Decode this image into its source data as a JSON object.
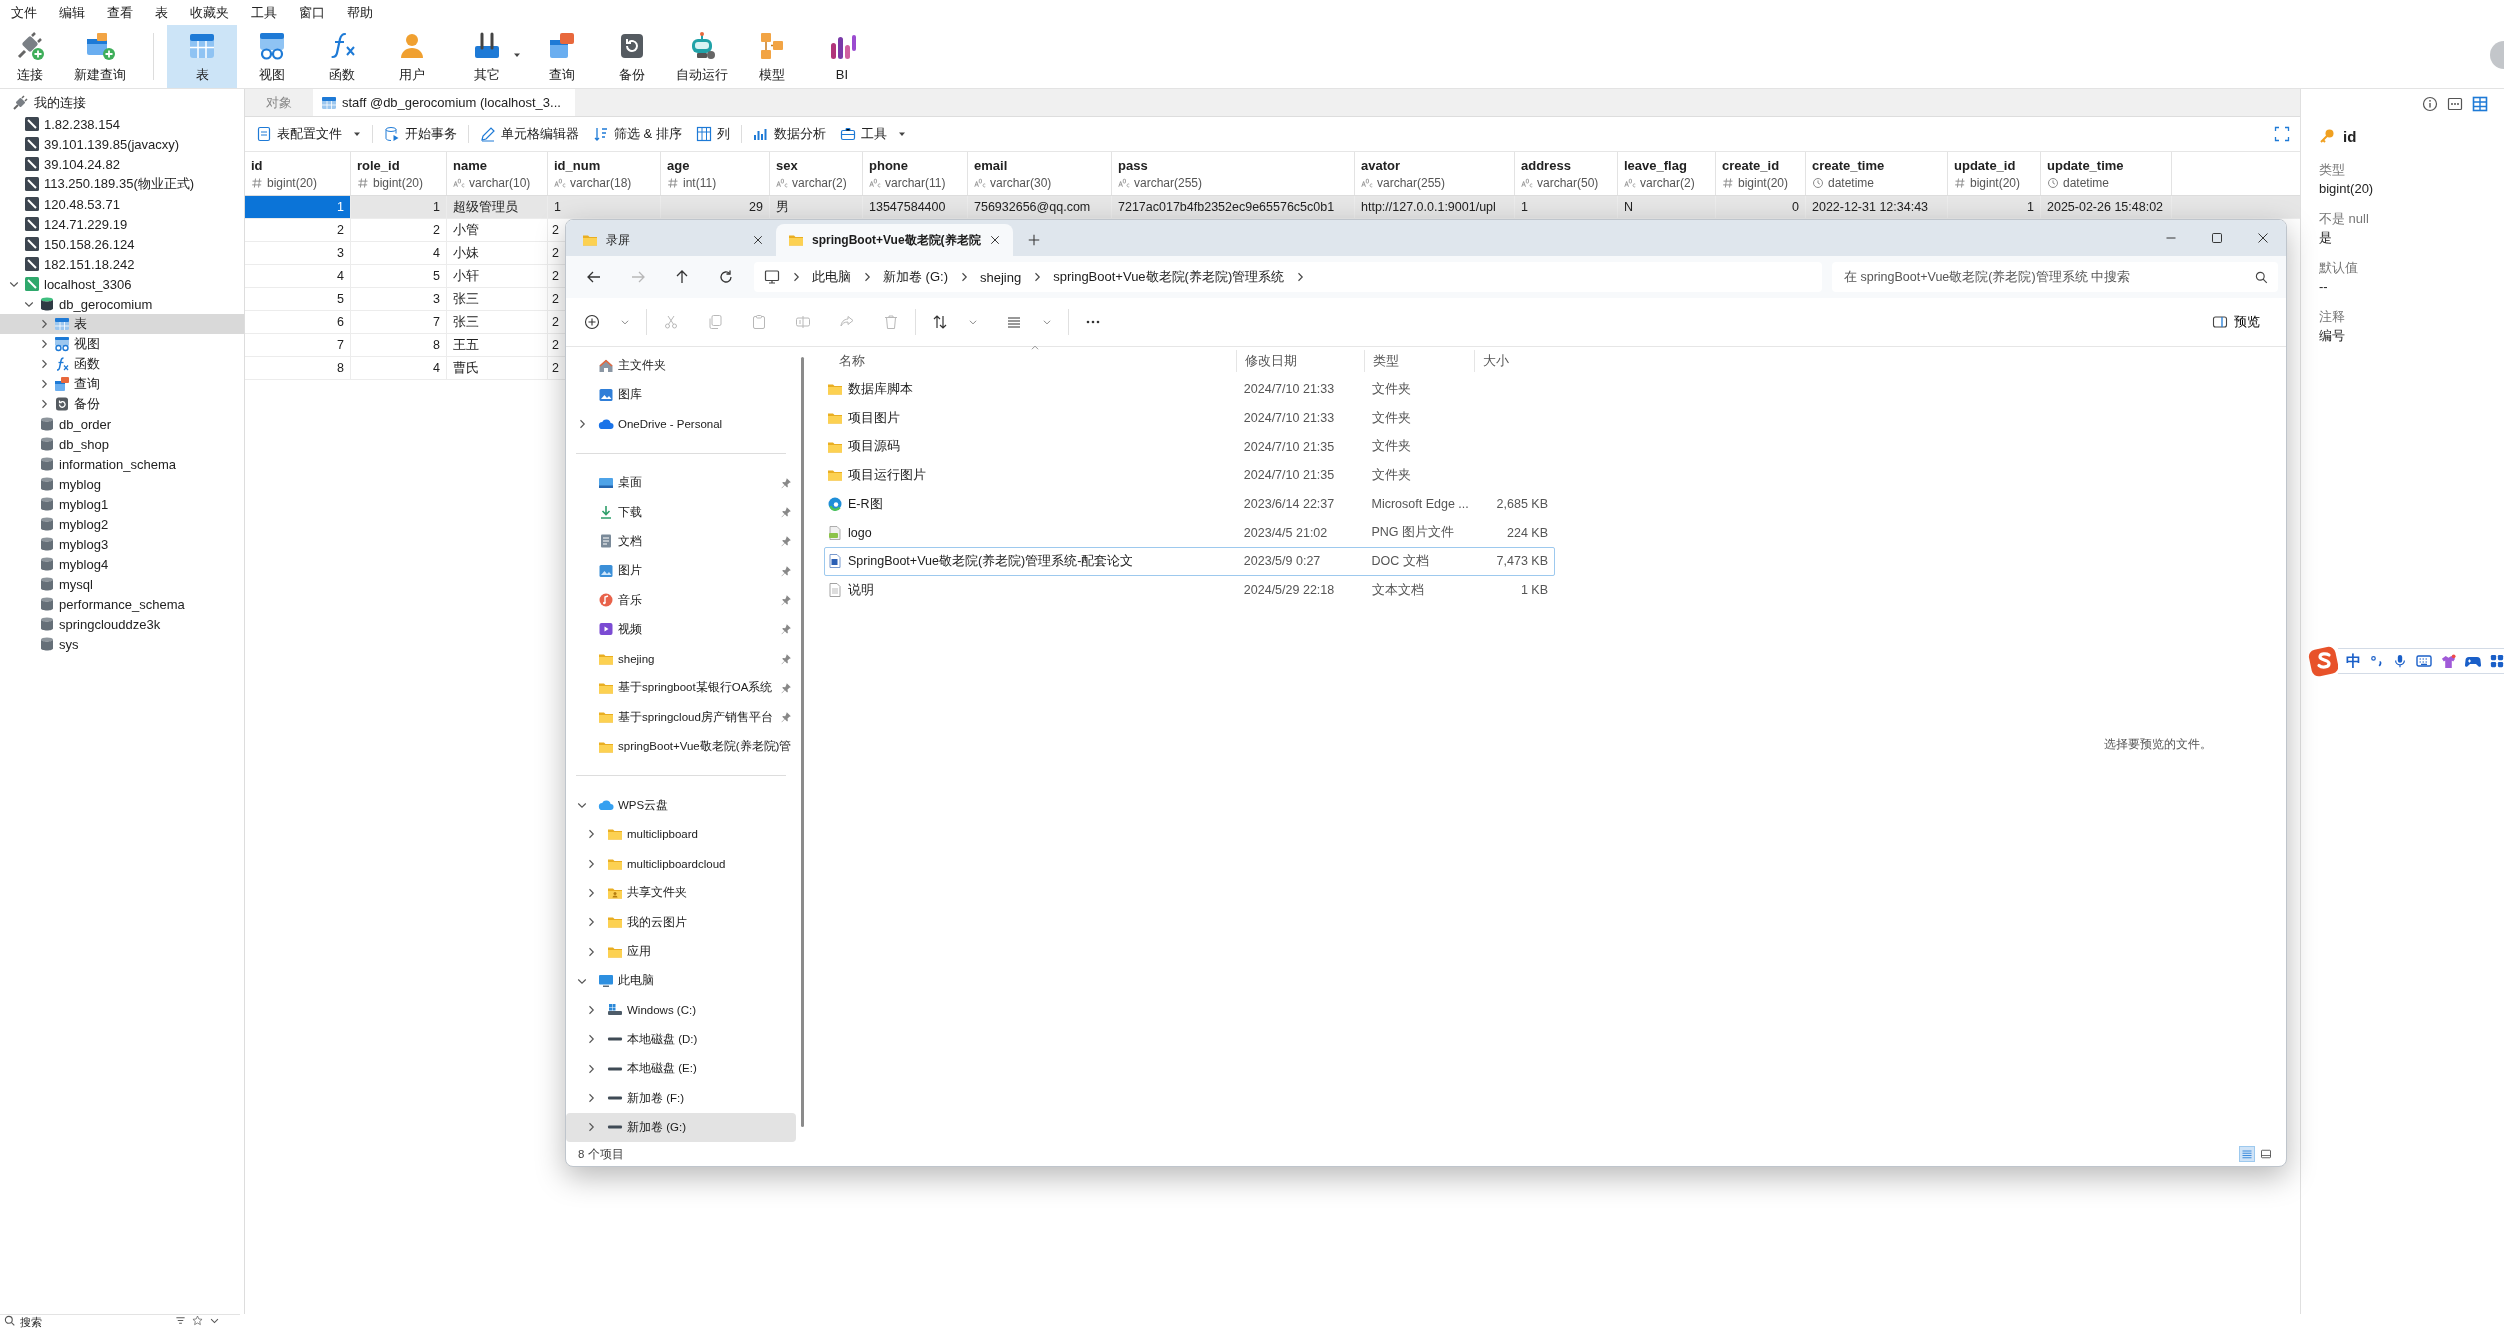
{
  "menu": [
    "文件",
    "编辑",
    "查看",
    "表",
    "收藏夹",
    "工具",
    "窗口",
    "帮助"
  ],
  "toolbar": [
    {
      "label": "连接",
      "selected": false,
      "has_menu": false
    },
    {
      "label": "新建查询",
      "selected": false,
      "has_menu": false
    },
    {
      "label": "表",
      "selected": true,
      "has_menu": false
    },
    {
      "label": "视图",
      "selected": false,
      "has_menu": false
    },
    {
      "label": "函数",
      "selected": false,
      "has_menu": false
    },
    {
      "label": "用户",
      "selected": false,
      "has_menu": false
    },
    {
      "label": "其它",
      "selected": false,
      "has_menu": true
    },
    {
      "label": "查询",
      "selected": false,
      "has_menu": false
    },
    {
      "label": "备份",
      "selected": false,
      "has_menu": false
    },
    {
      "label": "自动运行",
      "selected": false,
      "has_menu": false
    },
    {
      "label": "模型",
      "selected": false,
      "has_menu": false
    },
    {
      "label": "BI",
      "selected": false,
      "has_menu": false
    }
  ],
  "sidebar": {
    "title": "我的连接",
    "items": [
      {
        "label": "1.82.238.154",
        "kind": "connection",
        "selected": false
      },
      {
        "label": "39.101.139.85(javacxy)",
        "kind": "connection",
        "selected": false
      },
      {
        "label": "39.104.24.82",
        "kind": "connection",
        "selected": false
      },
      {
        "label": "113.250.189.35(物业正式)",
        "kind": "connection",
        "selected": false
      },
      {
        "label": "120.48.53.71",
        "kind": "connection",
        "selected": false
      },
      {
        "label": "124.71.229.19",
        "kind": "connection",
        "selected": false
      },
      {
        "label": "150.158.26.124",
        "kind": "connection",
        "selected": false
      },
      {
        "label": "182.151.18.242",
        "kind": "connection",
        "selected": false
      },
      {
        "label": "localhost_3306",
        "kind": "connection-open",
        "selected": false,
        "expanded": true,
        "children": [
          {
            "label": "db_gerocomium",
            "kind": "database-open",
            "selected": false,
            "expanded": true,
            "children": [
              {
                "label": "表",
                "kind": "tables",
                "selected": true,
                "expanded": false
              },
              {
                "label": "视图",
                "kind": "views",
                "selected": false,
                "expanded": false
              },
              {
                "label": "函数",
                "kind": "functions",
                "selected": false,
                "expanded": false
              },
              {
                "label": "查询",
                "kind": "queries",
                "selected": false,
                "expanded": false
              },
              {
                "label": "备份",
                "kind": "backups",
                "selected": false,
                "expanded": false
              }
            ]
          },
          {
            "label": "db_order",
            "kind": "database",
            "selected": false
          },
          {
            "label": "db_shop",
            "kind": "database",
            "selected": false
          },
          {
            "label": "information_schema",
            "kind": "database",
            "selected": false
          },
          {
            "label": "myblog",
            "kind": "database",
            "selected": false
          },
          {
            "label": "myblog1",
            "kind": "database",
            "selected": false
          },
          {
            "label": "myblog2",
            "kind": "database",
            "selected": false
          },
          {
            "label": "myblog3",
            "kind": "database",
            "selected": false
          },
          {
            "label": "myblog4",
            "kind": "database",
            "selected": false
          },
          {
            "label": "mysql",
            "kind": "database",
            "selected": false
          },
          {
            "label": "performance_schema",
            "kind": "database",
            "selected": false
          },
          {
            "label": "springclouddze3k",
            "kind": "database",
            "selected": false
          },
          {
            "label": "sys",
            "kind": "database",
            "selected": false
          }
        ]
      }
    ]
  },
  "tabs": [
    {
      "label": "对象",
      "kind": "objects",
      "selected": false
    },
    {
      "label": "staff @db_gerocomium (localhost_3...",
      "kind": "table",
      "selected": true
    }
  ],
  "table_toolbar": [
    {
      "label": "表配置文件",
      "has_menu": true
    },
    {
      "label": "开始事务",
      "has_menu": false
    },
    {
      "label": "单元格编辑器",
      "has_menu": false
    },
    {
      "label": "筛选 & 排序",
      "has_menu": false
    },
    {
      "label": "列",
      "has_menu": false
    },
    {
      "label": "数据分析",
      "has_menu": false
    },
    {
      "label": "工具",
      "has_menu": true
    }
  ],
  "table": {
    "columns": [
      {
        "name": "id",
        "type": "bigint(20)",
        "kind": "number"
      },
      {
        "name": "role_id",
        "type": "bigint(20)",
        "kind": "number"
      },
      {
        "name": "name",
        "type": "varchar(10)",
        "kind": "text"
      },
      {
        "name": "id_num",
        "type": "varchar(18)",
        "kind": "text"
      },
      {
        "name": "age",
        "type": "int(11)",
        "kind": "number"
      },
      {
        "name": "sex",
        "type": "varchar(2)",
        "kind": "text"
      },
      {
        "name": "phone",
        "type": "varchar(11)",
        "kind": "text"
      },
      {
        "name": "email",
        "type": "varchar(30)",
        "kind": "text"
      },
      {
        "name": "pass",
        "type": "varchar(255)",
        "kind": "text"
      },
      {
        "name": "avator",
        "type": "varchar(255)",
        "kind": "text"
      },
      {
        "name": "address",
        "type": "varchar(50)",
        "kind": "text"
      },
      {
        "name": "leave_flag",
        "type": "varchar(2)",
        "kind": "text"
      },
      {
        "name": "create_id",
        "type": "bigint(20)",
        "kind": "number"
      },
      {
        "name": "create_time",
        "type": "datetime",
        "kind": "datetime"
      },
      {
        "name": "update_id",
        "type": "bigint(20)",
        "kind": "number"
      },
      {
        "name": "update_time",
        "type": "datetime",
        "kind": "datetime"
      }
    ],
    "rows": [
      {
        "selected": true,
        "cells": [
          "1",
          "1",
          "超级管理员",
          "1",
          "29",
          "男",
          "13547584400",
          "756932656@qq.com",
          "7217ac017b4fb2352ec9e65576c5c0b1",
          "http://127.0.0.1:9001/upl",
          "1",
          "N",
          "0",
          "2022-12-31 12:34:43",
          "1",
          "2025-02-26 15:48:02"
        ]
      },
      {
        "selected": false,
        "cells": [
          "2",
          "2",
          "小管",
          "2"
        ]
      },
      {
        "selected": false,
        "cells": [
          "3",
          "4",
          "小妹",
          "2"
        ]
      },
      {
        "selected": false,
        "cells": [
          "4",
          "5",
          "小轩",
          "2"
        ]
      },
      {
        "selected": false,
        "cells": [
          "5",
          "3",
          "张三",
          "2"
        ]
      },
      {
        "selected": false,
        "cells": [
          "6",
          "7",
          "张三",
          "2"
        ]
      },
      {
        "selected": false,
        "cells": [
          "7",
          "8",
          "王五",
          "2"
        ]
      },
      {
        "selected": false,
        "cells": [
          "8",
          "4",
          "曹氏",
          "2"
        ]
      }
    ]
  },
  "field_panel": {
    "view_buttons": [
      {
        "kind": "info",
        "selected": false
      },
      {
        "kind": "ddl",
        "selected": false
      },
      {
        "kind": "fields",
        "selected": true
      }
    ],
    "name": "id",
    "props": [
      {
        "label": "类型",
        "value": "bigint(20)"
      },
      {
        "label": "不是 null",
        "value": "是"
      },
      {
        "label": "默认值",
        "value": "--"
      },
      {
        "label": "注释",
        "value": "编号"
      }
    ]
  },
  "explorer": {
    "tabs": [
      {
        "label": "录屏",
        "selected": false
      },
      {
        "label": "springBoot+Vue敬老院(养老院",
        "selected": true
      }
    ],
    "nav_buttons": [
      {
        "kind": "back",
        "disabled": false
      },
      {
        "kind": "forward",
        "disabled": true
      },
      {
        "kind": "up",
        "disabled": false
      },
      {
        "kind": "refresh",
        "disabled": false
      }
    ],
    "breadcrumb": [
      "此电脑",
      "新加卷 (G:)",
      "shejing",
      "springBoot+Vue敬老院(养老院)管理系统"
    ],
    "search": {
      "placeholder": "在 springBoot+Vue敬老院(养老院)管理系统 中搜索"
    },
    "commands": [
      {
        "kind": "new",
        "disabled": false,
        "has_menu": true
      },
      {
        "kind": "cut",
        "disabled": true,
        "has_menu": false
      },
      {
        "kind": "copy",
        "disabled": true,
        "has_menu": false
      },
      {
        "kind": "paste",
        "disabled": true,
        "has_menu": false
      },
      {
        "kind": "rename",
        "disabled": true,
        "has_menu": false
      },
      {
        "kind": "share",
        "disabled": true,
        "has_menu": false
      },
      {
        "kind": "delete",
        "disabled": true,
        "has_menu": false
      },
      {
        "kind": "sort",
        "disabled": false,
        "has_menu": true
      },
      {
        "kind": "view",
        "disabled": false,
        "has_menu": true
      },
      {
        "kind": "more",
        "disabled": false,
        "has_menu": false
      }
    ],
    "preview_button": "预览",
    "nav": [
      [
        {
          "label": "主文件夹",
          "kind": "home",
          "selected": false
        },
        {
          "label": "图库",
          "kind": "gallery",
          "selected": false
        },
        {
          "label": "OneDrive - Personal",
          "kind": "cloud",
          "selected": false,
          "expanded": false
        }
      ],
      [
        {
          "label": "桌面",
          "kind": "desktop",
          "selected": false,
          "pinned": true
        },
        {
          "label": "下载",
          "kind": "download",
          "selected": false,
          "pinned": true
        },
        {
          "label": "文档",
          "kind": "document",
          "selected": false,
          "pinned": true
        },
        {
          "label": "图片",
          "kind": "pictures",
          "selected": false,
          "pinned": true
        },
        {
          "label": "音乐",
          "kind": "music",
          "selected": false,
          "pinned": true
        },
        {
          "label": "视频",
          "kind": "video",
          "selected": false,
          "pinned": true
        },
        {
          "label": "shejing",
          "kind": "folder",
          "selected": false,
          "pinned": true
        },
        {
          "label": "基于springboot某银行OA系统",
          "kind": "folder",
          "selected": false,
          "pinned": true
        },
        {
          "label": "基于springcloud房产销售平台",
          "kind": "folder",
          "selected": false,
          "pinned": true
        },
        {
          "label": "springBoot+Vue敬老院(养老院)管",
          "kind": "folder",
          "selected": false,
          "pinned": false
        }
      ],
      [
        {
          "label": "WPS云盘",
          "kind": "wps",
          "selected": false,
          "expanded": true,
          "children": [
            {
              "label": "multiclipboard",
              "kind": "folder",
              "selected": false,
              "expanded": false
            },
            {
              "label": "multiclipboardcloud",
              "kind": "folder",
              "selected": false,
              "expanded": false
            },
            {
              "label": "共享文件夹",
              "kind": "shared",
              "selected": false,
              "expanded": false
            },
            {
              "label": "我的云图片",
              "kind": "folder",
              "selected": false,
              "expanded": false
            },
            {
              "label": "应用",
              "kind": "folder",
              "selected": false,
              "expanded": false
            }
          ]
        },
        {
          "label": "此电脑",
          "kind": "pc",
          "selected": false,
          "expanded": true,
          "children": [
            {
              "label": "Windows (C:)",
              "kind": "windows-drive",
              "selected": false,
              "expanded": false
            },
            {
              "label": "本地磁盘 (D:)",
              "kind": "drive",
              "selected": false,
              "expanded": false
            },
            {
              "label": "本地磁盘 (E:)",
              "kind": "drive",
              "selected": false,
              "expanded": false
            },
            {
              "label": "新加卷 (F:)",
              "kind": "drive",
              "selected": false,
              "expanded": false
            },
            {
              "label": "新加卷 (G:)",
              "kind": "drive",
              "selected": true,
              "expanded": false
            }
          ]
        }
      ]
    ],
    "columns": [
      "名称",
      "修改日期",
      "类型",
      "大小"
    ],
    "files": [
      {
        "name": "数据库脚本",
        "kind": "folder",
        "date": "2024/7/10 21:33",
        "type": "文件夹",
        "focused": false
      },
      {
        "name": "项目图片",
        "kind": "folder",
        "date": "2024/7/10 21:33",
        "type": "文件夹",
        "focused": false
      },
      {
        "name": "项目源码",
        "kind": "folder",
        "date": "2024/7/10 21:35",
        "type": "文件夹",
        "focused": false
      },
      {
        "name": "项目运行图片",
        "kind": "folder",
        "date": "2024/7/10 21:35",
        "type": "文件夹",
        "focused": false
      },
      {
        "name": "E-R图",
        "kind": "edge",
        "date": "2023/6/14 22:37",
        "type": "Microsoft Edge ...",
        "size": "2,685 KB",
        "focused": false
      },
      {
        "name": "logo",
        "kind": "png",
        "date": "2023/4/5 21:02",
        "type": "PNG 图片文件",
        "size": "224 KB",
        "focused": false
      },
      {
        "name": "SpringBoot+Vue敬老院(养老院)管理系统-配套论文",
        "kind": "doc",
        "date": "2023/5/9 0:27",
        "type": "DOC 文档",
        "size": "7,473 KB",
        "focused": true
      },
      {
        "name": "说明",
        "kind": "text",
        "date": "2024/5/29 22:18",
        "type": "文本文档",
        "size": "1 KB",
        "focused": false
      }
    ],
    "preview_hint": "选择要预览的文件。",
    "status": "8 个项目",
    "view_buttons": [
      {
        "kind": "details",
        "selected": true
      },
      {
        "kind": "tiles",
        "selected": false
      }
    ]
  },
  "ime": {
    "mode": "中"
  },
  "bottom_bar": {
    "search_label": "搜索"
  }
}
